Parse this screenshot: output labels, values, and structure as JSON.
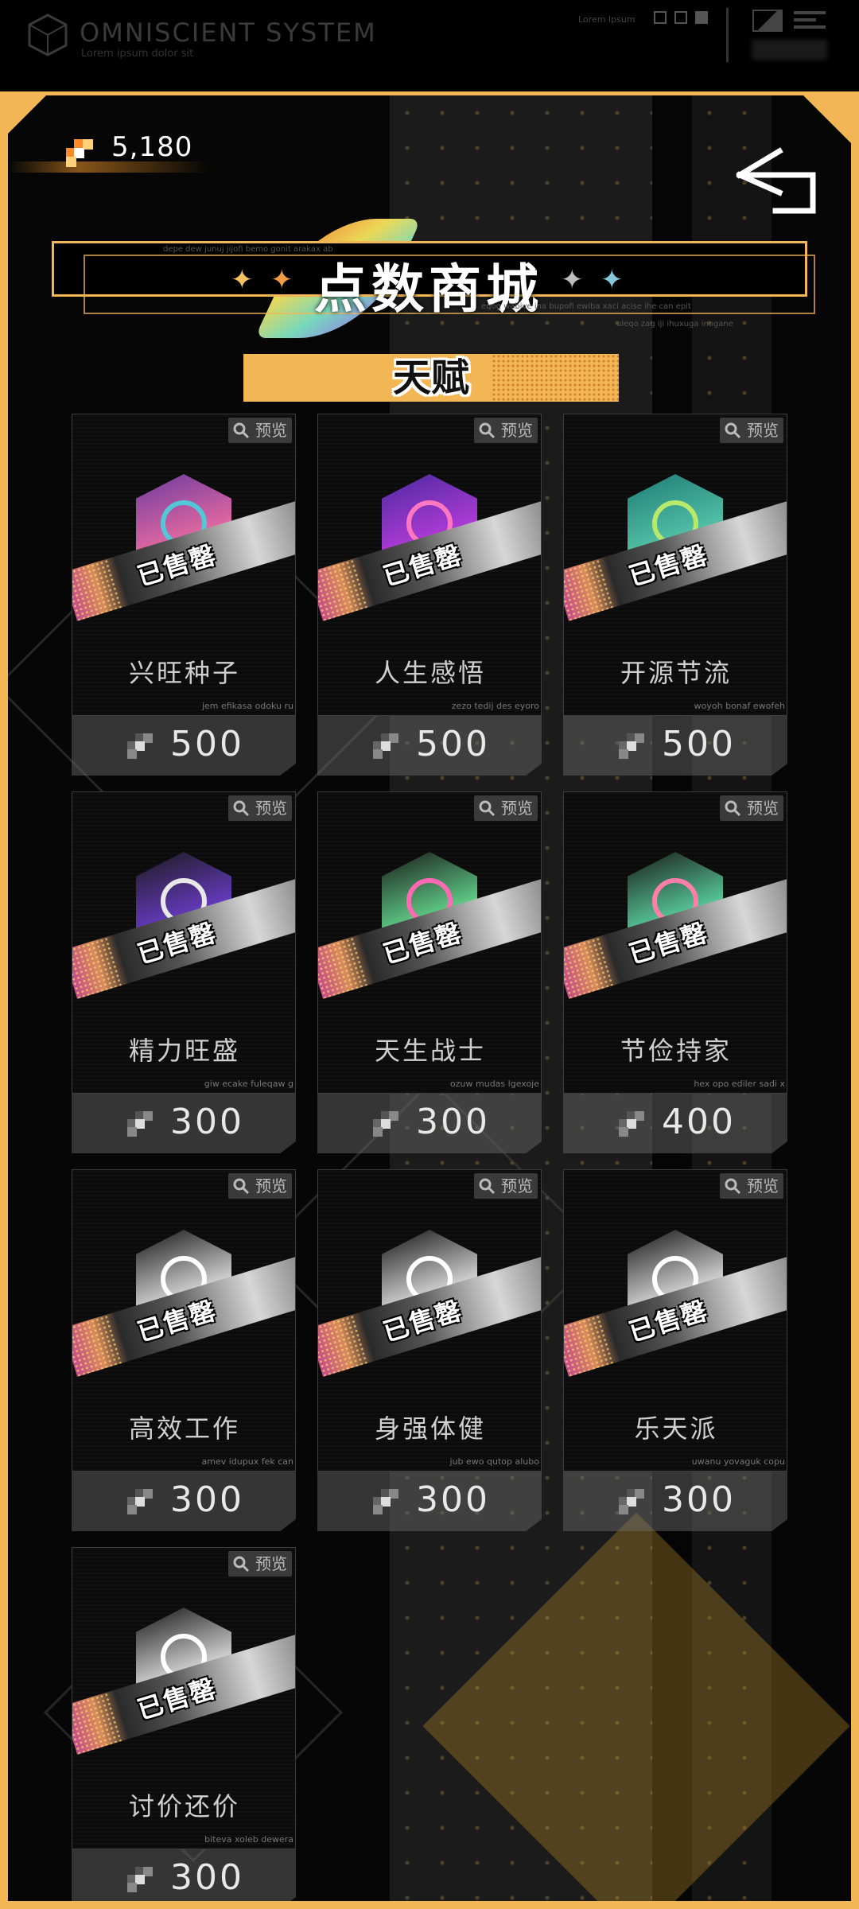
{
  "system": {
    "title": "OMNISCIENT SYSTEM",
    "subtitle": "Lorem ipsum dolor sit",
    "tag": "Lorem Ipsum"
  },
  "currency": {
    "value": "5,180",
    "icon": "point-coin-icon"
  },
  "header": {
    "title": "点数商城",
    "deco_line_1": "depe dew junuj jijofi bemo gonit arakax ab",
    "deco_line_2": "eqog wabive ina bupofi ewiba xaci acise ihe can epit",
    "deco_line_3": "uleqo zag iji ihuxuga inogane"
  },
  "tab": {
    "label": "天赋"
  },
  "preview_label": "预览",
  "sold_label": "已售罄",
  "items": [
    {
      "name": "兴旺种子",
      "price": "500",
      "caption": "jem efikasa odoku ru",
      "icon": "flower-seed-icon"
    },
    {
      "name": "人生感悟",
      "price": "500",
      "caption": "zezo tedij des eyoro",
      "icon": "winding-path-icon"
    },
    {
      "name": "开源节流",
      "price": "500",
      "caption": "woyoh bonaf ewofeh",
      "icon": "piggy-bank-icon"
    },
    {
      "name": "精力旺盛",
      "price": "300",
      "caption": "giw ecake fuleqaw g",
      "icon": "energy-icon"
    },
    {
      "name": "天生战士",
      "price": "300",
      "caption": "ozuw mudas lgexoje",
      "icon": "warrior-icon"
    },
    {
      "name": "节俭持家",
      "price": "400",
      "caption": "hex opo ediler sadi x",
      "icon": "household-icon"
    },
    {
      "name": "高效工作",
      "price": "300",
      "caption": "amev idupux fek can",
      "icon": "documents-icon"
    },
    {
      "name": "身强体健",
      "price": "300",
      "caption": "jub ewo qutop alubo",
      "icon": "strong-arm-icon"
    },
    {
      "name": "乐天派",
      "price": "300",
      "caption": "uwanu yovaguk copu",
      "icon": "cheering-hand-icon"
    },
    {
      "name": "讨价还价",
      "price": "300",
      "caption": "biteva xoleb dewera",
      "icon": "bargain-icon"
    }
  ],
  "colors": {
    "accent": "#f2b655",
    "price_panel": "#5e5e5e",
    "card_bg": "#0b0b0b"
  }
}
